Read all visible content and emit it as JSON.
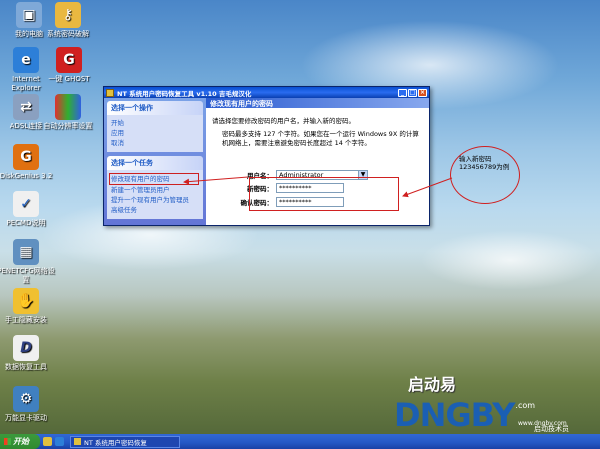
{
  "desktop": {
    "icons": [
      {
        "label": "我的电脑",
        "icon": "computer-icon",
        "color": "#7fa9d8"
      },
      {
        "label": "系统密码破解",
        "icon": "key-icon",
        "color": "#e9b840"
      },
      {
        "label": "Internet Explorer",
        "icon": "ie-icon",
        "color": "#2d7fd8"
      },
      {
        "label": "一键 GHOST",
        "icon": "ghost-icon",
        "color": "#d02020"
      },
      {
        "label": "ADSL连接",
        "icon": "network-icon",
        "color": "#8aa0c0"
      },
      {
        "label": "自动分辨率设置",
        "icon": "display-icon",
        "color": "#50a040"
      },
      {
        "label": "DiskGenius 3.2",
        "icon": "disk-icon",
        "color": "#e07010"
      },
      {
        "label": "PECMD说明",
        "icon": "doc-icon",
        "color": "#f0f0f0"
      },
      {
        "label": "PENETCFG网络设置",
        "icon": "netcfg-icon",
        "color": "#6090c0"
      },
      {
        "label": "手工隐藏安装",
        "icon": "install-icon",
        "color": "#f0c030"
      },
      {
        "label": "数据恢复工具",
        "icon": "recover-icon",
        "color": "#304080"
      },
      {
        "label": "万能显卡驱动",
        "icon": "driver-icon",
        "color": "#4080c0"
      }
    ]
  },
  "window": {
    "title": "NT 系统用户密码恢复工具 v1.10 吉毛规汉化",
    "min": "_",
    "max": "□",
    "close": "×",
    "sidebar": {
      "group1_title": "选择一个操作",
      "group1_items": [
        "开始",
        "应用",
        "取消"
      ],
      "group2_title": "选择一个任务",
      "group2_items": [
        "修改现有用户的密码",
        "新建一个管理员用户",
        "提升一个现有用户为管理员",
        "高级任务"
      ]
    },
    "panel": {
      "header": "修改现有用户的密码",
      "intro": "请选择您要修改密码的用户名，并输入新的密码。",
      "note": "密码最多支持 127 个字符。如果您在一个运行 Windows 9X 的计算机网络上，需要注意避免密码长度超过 14 个字符。",
      "username_label": "用户名：",
      "username_value": "Administrator",
      "newpw_label": "新密码：",
      "newpw_value": "**********",
      "confirmpw_label": "确认密码：",
      "confirmpw_value": "**********"
    }
  },
  "annotation": {
    "callout_line1": "输入新密码",
    "callout_line2": "123456789为例",
    "color": "#d02020"
  },
  "brand": {
    "cn": "启动易",
    "logo": "DNGBY",
    "com": ".com",
    "tag": "启动技术员",
    "url": "www.dngby.com"
  },
  "taskbar": {
    "start": "开始",
    "task_item": "NT 系统用户密码恢复"
  }
}
